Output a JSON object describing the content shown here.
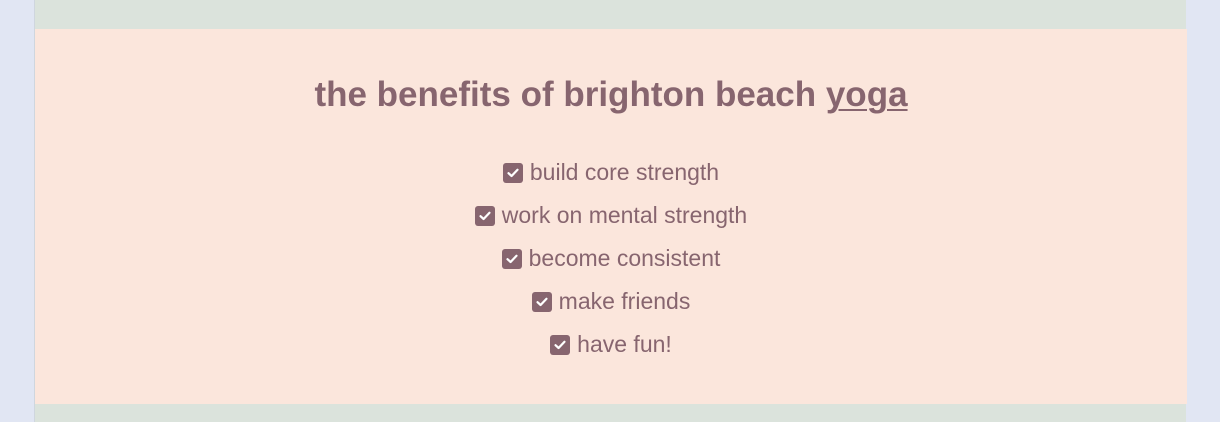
{
  "benefits": {
    "title_main": "the benefits of brighton beach ",
    "title_underlined": "yoga",
    "items": [
      {
        "label": "build core strength",
        "icon": "check-square-icon"
      },
      {
        "label": "work on mental strength",
        "icon": "check-square-icon"
      },
      {
        "label": "become consistent",
        "icon": "check-square-icon"
      },
      {
        "label": "make friends",
        "icon": "check-square-icon"
      },
      {
        "label": "have fun!",
        "icon": "check-square-icon"
      }
    ]
  },
  "colors": {
    "page_background": "#e1e6f3",
    "band_background": "#dbe3dc",
    "section_background": "#fbe6dc",
    "text": "#87656f"
  }
}
